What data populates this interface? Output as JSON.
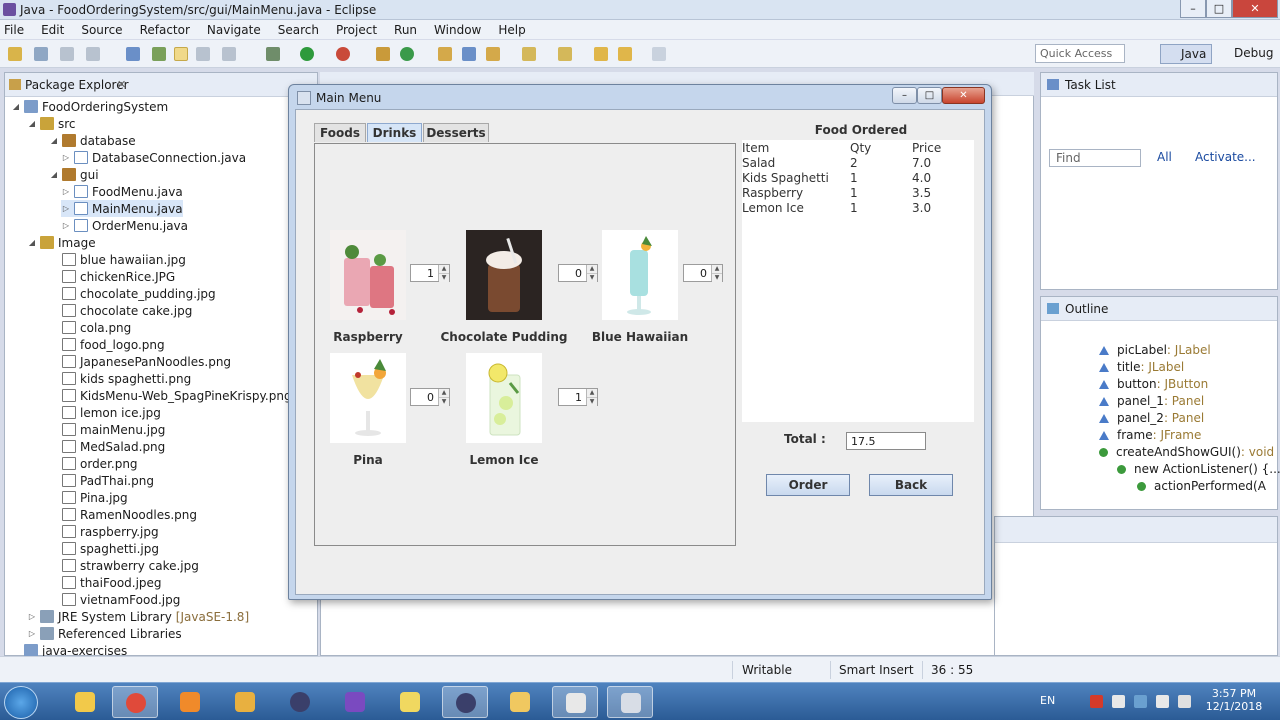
{
  "window": {
    "title": "Java - FoodOrderingSystem/src/gui/MainMenu.java - Eclipse",
    "controls": {
      "minimize": "–",
      "maximize": "□",
      "close": "✕"
    }
  },
  "menubar": [
    "File",
    "Edit",
    "Source",
    "Refactor",
    "Navigate",
    "Search",
    "Project",
    "Run",
    "Window",
    "Help"
  ],
  "toolbar": {
    "quick_access_placeholder": "Quick Access",
    "perspectives": {
      "java": "Java",
      "debug": "Debug"
    }
  },
  "package_explorer": {
    "title": "Package Explorer",
    "close_icon": "✕",
    "tree": [
      {
        "label": "FoodOrderingSystem",
        "icon": "project-icon",
        "toggle": "◢"
      },
      {
        "label": "src",
        "icon": "source-folder-icon",
        "toggle": "◢"
      },
      {
        "label": "database",
        "icon": "package-icon",
        "toggle": "◢"
      },
      {
        "label": "DatabaseConnection.java",
        "icon": "java-file-icon",
        "toggle": "▷"
      },
      {
        "label": "gui",
        "icon": "package-icon",
        "toggle": "◢"
      },
      {
        "label": "FoodMenu.java",
        "icon": "java-file-icon",
        "toggle": "▷"
      },
      {
        "label": "MainMenu.java",
        "icon": "java-file-icon",
        "toggle": "▷",
        "selected": true
      },
      {
        "label": "OrderMenu.java",
        "icon": "java-file-icon",
        "toggle": "▷"
      },
      {
        "label": "Image",
        "icon": "folder-icon",
        "toggle": "◢"
      },
      {
        "label": "blue hawaiian.jpg",
        "icon": "image-file-icon"
      },
      {
        "label": "chickenRice.JPG",
        "icon": "image-file-icon"
      },
      {
        "label": "chocolate_pudding.jpg",
        "icon": "image-file-icon"
      },
      {
        "label": "chocolate cake.jpg",
        "icon": "image-file-icon"
      },
      {
        "label": "cola.png",
        "icon": "image-file-icon"
      },
      {
        "label": "food_logo.png",
        "icon": "image-file-icon"
      },
      {
        "label": "JapanesePanNoodles.png",
        "icon": "image-file-icon"
      },
      {
        "label": "kids spaghetti.png",
        "icon": "image-file-icon"
      },
      {
        "label": "KidsMenu-Web_SpagPineKrispy.png",
        "icon": "image-file-icon"
      },
      {
        "label": "lemon ice.jpg",
        "icon": "image-file-icon"
      },
      {
        "label": "mainMenu.jpg",
        "icon": "image-file-icon"
      },
      {
        "label": "MedSalad.png",
        "icon": "image-file-icon"
      },
      {
        "label": "order.png",
        "icon": "image-file-icon"
      },
      {
        "label": "PadThai.png",
        "icon": "image-file-icon"
      },
      {
        "label": "Pina.jpg",
        "icon": "image-file-icon"
      },
      {
        "label": "RamenNoodles.png",
        "icon": "image-file-icon"
      },
      {
        "label": "raspberry.jpg",
        "icon": "image-file-icon"
      },
      {
        "label": "spaghetti.jpg",
        "icon": "image-file-icon"
      },
      {
        "label": "strawberry cake.jpg",
        "icon": "image-file-icon"
      },
      {
        "label": "thaiFood.jpeg",
        "icon": "image-file-icon"
      },
      {
        "label": "vietnamFood.jpg",
        "icon": "image-file-icon"
      },
      {
        "label": "JRE System Library",
        "suffix": "[JavaSE-1.8]",
        "icon": "library-icon",
        "toggle": "▷"
      },
      {
        "label": "Referenced Libraries",
        "icon": "library-icon",
        "toggle": "▷"
      },
      {
        "label": "java-exercises",
        "icon": "project-icon"
      }
    ]
  },
  "task_list": {
    "title": "Task List",
    "find_placeholder": "Find",
    "all": "All",
    "activate": "Activate..."
  },
  "outline": {
    "title": "Outline",
    "items": [
      {
        "name": "picLabel",
        "type": " : JLabel",
        "marker": "field"
      },
      {
        "name": "title",
        "type": " : JLabel",
        "marker": "field"
      },
      {
        "name": "button",
        "type": " : JButton",
        "marker": "field"
      },
      {
        "name": "panel_1",
        "type": " : Panel",
        "marker": "field"
      },
      {
        "name": "panel_2",
        "type": " : Panel",
        "marker": "field"
      },
      {
        "name": "frame",
        "type": " : JFrame",
        "marker": "static-field"
      },
      {
        "name": "createAndShowGUI()",
        "type": " : void",
        "marker": "method"
      },
      {
        "name": "new ActionListener() {...",
        "type": "",
        "marker": "anonymous"
      },
      {
        "name": "actionPerformed(A",
        "type": "",
        "marker": "method"
      }
    ]
  },
  "statusbar": {
    "writable": "Writable",
    "insert_mode": "Smart Insert",
    "position": "36 : 55"
  },
  "taskbar": {
    "lang": "EN",
    "time": "3:57 PM",
    "date": "12/1/2018"
  },
  "dialog": {
    "title": "Main Menu",
    "tabs": [
      "Foods",
      "Drinks",
      "Desserts"
    ],
    "active_tab": "Drinks",
    "products": [
      {
        "name": "Raspberry",
        "qty": "1"
      },
      {
        "name": "Chocolate Pudding",
        "qty": "0"
      },
      {
        "name": "Blue Hawaiian",
        "qty": "0"
      },
      {
        "name": "Pina",
        "qty": "0"
      },
      {
        "name": "Lemon Ice",
        "qty": "1"
      }
    ],
    "order": {
      "title": "Food Ordered",
      "headers": [
        "Item",
        "Qty",
        "Price"
      ],
      "rows": [
        [
          "Salad",
          "2",
          "7.0"
        ],
        [
          "Kids Spaghetti",
          "1",
          "4.0"
        ],
        [
          "Raspberry",
          "1",
          "3.5"
        ],
        [
          "Lemon Ice",
          "1",
          "3.0"
        ]
      ],
      "total_label": "Total :",
      "total_value": "17.5"
    },
    "buttons": {
      "order": "Order",
      "back": "Back"
    }
  }
}
